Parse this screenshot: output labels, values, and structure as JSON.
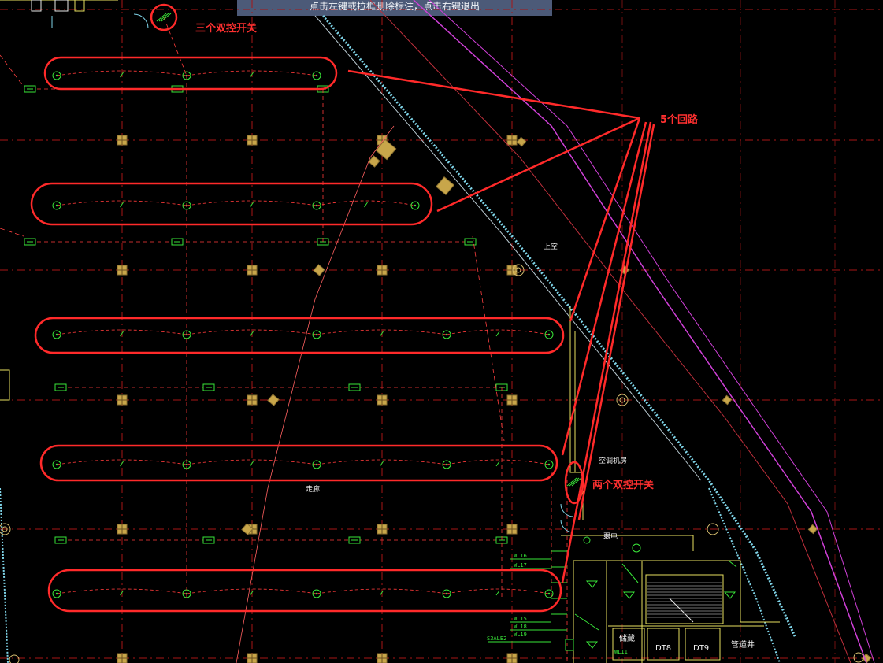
{
  "toolbar": {
    "hint": "点击左键或拉框删除标注，点击右键退出"
  },
  "annotations": {
    "three_switch": "三个双控开关",
    "five_circuits": "5个回路",
    "two_switch": "两个双控开关"
  },
  "rooms": {
    "void_label": "上空",
    "ac_room": "空调机房",
    "corridor": "走廊",
    "weak_current": "弱电",
    "storage": "储藏",
    "dt1": "DT8",
    "dt2": "DT9",
    "water_well": "管道井"
  },
  "circuit_tags": {
    "t1": "WL16",
    "t2": "WL17",
    "t3": "WL15",
    "t4": "WL18",
    "t5": "WL19",
    "t6": "WL11",
    "t7": "S3ALE2"
  },
  "colors": {
    "background": "#000000",
    "grid_line": "#b01818",
    "circuit": "#ff3a3a",
    "fixture": "#39e639",
    "column": "#c8a64a",
    "wall_yellow": "#e8e060",
    "boundary_magenta": "#d040d8",
    "boundary_cyan": "#7fd4e8",
    "markup_red": "#ff2a2a"
  }
}
